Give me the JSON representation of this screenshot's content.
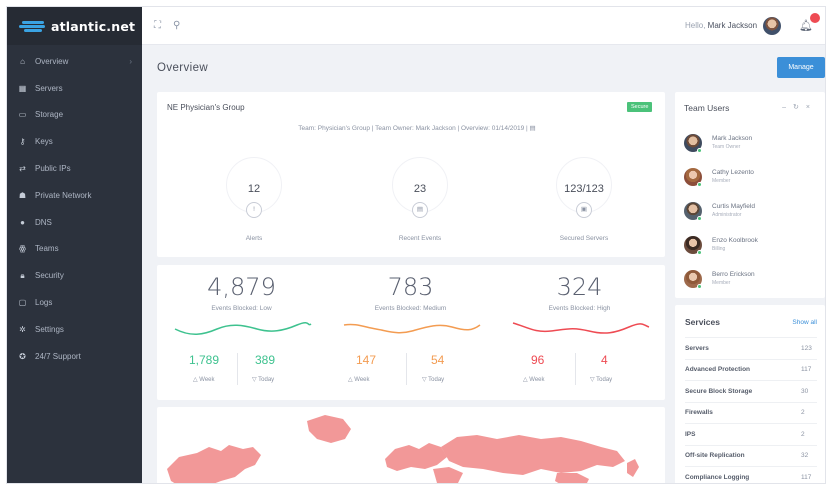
{
  "brand": {
    "name": "atlantic.net"
  },
  "sidebar": {
    "items": [
      {
        "label": "Overview",
        "icon": "home-icon"
      },
      {
        "label": "Servers",
        "icon": "servers-icon"
      },
      {
        "label": "Storage",
        "icon": "storage-icon"
      },
      {
        "label": "Keys",
        "icon": "key-icon"
      },
      {
        "label": "Public IPs",
        "icon": "arrows-icon"
      },
      {
        "label": "Private Network",
        "icon": "network-icon"
      },
      {
        "label": "DNS",
        "icon": "dns-icon"
      },
      {
        "label": "Teams",
        "icon": "teams-icon"
      },
      {
        "label": "Security",
        "icon": "lock-icon"
      },
      {
        "label": "Logs",
        "icon": "logs-icon"
      },
      {
        "label": "Settings",
        "icon": "gear-icon"
      },
      {
        "label": "24/7 Support",
        "icon": "support-icon"
      }
    ]
  },
  "topbar": {
    "greeting": "Hello,",
    "user_name": "Mark Jackson"
  },
  "page": {
    "title": "Overview",
    "manage_label": "Manage"
  },
  "group": {
    "name": "NE Physician's Group",
    "badge": "Secure",
    "info": "Team: Physician's Group  |  Team Owner: Mark Jackson  |  Overview: 01/14/2019  |",
    "stats": [
      {
        "value": "12",
        "icon": "!",
        "label": "Alerts"
      },
      {
        "value": "23",
        "icon": "▤",
        "label": "Recent Events"
      },
      {
        "value": "123/123",
        "icon": "▣",
        "label": "Secured Servers"
      }
    ]
  },
  "events": [
    {
      "total": "4,879",
      "label": "Events Blocked: Low",
      "color": "#3ec28f",
      "week": "1,789",
      "today": "389",
      "week_label": "△ Week",
      "today_label": "▽ Today"
    },
    {
      "total": "783",
      "label": "Events Blocked: Medium",
      "color": "#f39c52",
      "week": "147",
      "today": "54",
      "week_label": "△ Week",
      "today_label": "▽ Today"
    },
    {
      "total": "324",
      "label": "Events Blocked: High",
      "color": "#ee4b53",
      "week": "96",
      "today": "4",
      "week_label": "△ Week",
      "today_label": "▽ Today"
    }
  ],
  "team": {
    "title": "Team Users",
    "users": [
      {
        "name": "Mark Jackson",
        "role": "Team Owner"
      },
      {
        "name": "Cathy Lezento",
        "role": "Member"
      },
      {
        "name": "Curtis Mayfield",
        "role": "Administrator"
      },
      {
        "name": "Enzo Koolbrook",
        "role": "Billing"
      },
      {
        "name": "Berro Erickson",
        "role": "Member"
      }
    ]
  },
  "services": {
    "title": "Services",
    "show_all": "Show all",
    "items": [
      {
        "name": "Servers",
        "count": "123"
      },
      {
        "name": "Advanced Protection",
        "count": "117"
      },
      {
        "name": "Secure Block Storage",
        "count": "30"
      },
      {
        "name": "Firewalls",
        "count": "2"
      },
      {
        "name": "IPS",
        "count": "2"
      },
      {
        "name": "Off-site Replication",
        "count": "32"
      },
      {
        "name": "Compliance Logging",
        "count": "117"
      }
    ]
  },
  "colors": {
    "sidebar": "#2c323d",
    "accent": "#3b8fd8",
    "secure": "#4bc27a",
    "map": "#f29898"
  }
}
